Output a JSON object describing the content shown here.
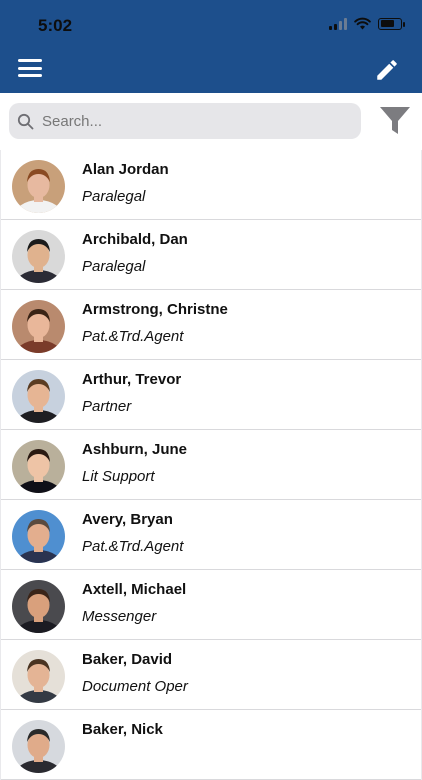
{
  "status_bar": {
    "time": "5:02"
  },
  "header": {
    "menu_icon": "hamburger-menu-icon",
    "edit_icon": "pencil-icon"
  },
  "search": {
    "placeholder": "Search...",
    "value": "",
    "icon": "search-icon",
    "filter_icon": "filter-funnel-icon"
  },
  "contacts": [
    {
      "name": "Alan Jordan",
      "title": "Paralegal",
      "skin": "#e7b9a0",
      "hair": "#8a4a22",
      "shirt": "#f2f2f2",
      "bg": "#c8a07a"
    },
    {
      "name": "Archibald, Dan",
      "title": "Paralegal",
      "skin": "#e0b28e",
      "hair": "#1b1b1b",
      "shirt": "#2b2b35",
      "bg": "#d9d9d9"
    },
    {
      "name": "Armstrong, Christne",
      "title": "Pat.&Trd.Agent",
      "skin": "#e9b79a",
      "hair": "#3a2416",
      "shirt": "#7a3b2a",
      "bg": "#b98a6e"
    },
    {
      "name": "Arthur, Trevor",
      "title": "Partner",
      "skin": "#e6b594",
      "hair": "#5a3c22",
      "shirt": "#1e1e22",
      "bg": "#c7d1de"
    },
    {
      "name": "Ashburn, June",
      "title": "Lit Support",
      "skin": "#eec4a6",
      "hair": "#2a1a12",
      "shirt": "#101018",
      "bg": "#b9b09b"
    },
    {
      "name": "Avery, Bryan",
      "title": "Pat.&Trd.Agent",
      "skin": "#e3ae8e",
      "hair": "#5a4a3e",
      "shirt": "#2a3350",
      "bg": "#4f8fd0"
    },
    {
      "name": "Axtell, Michael",
      "title": "Messenger",
      "skin": "#d9a07c",
      "hair": "#3a2418",
      "shirt": "#1b1b22",
      "bg": "#4a4a4e"
    },
    {
      "name": "Baker, David",
      "title": "Document Oper",
      "skin": "#e4b495",
      "hair": "#4a3422",
      "shirt": "#343a44",
      "bg": "#e5e0d8"
    },
    {
      "name": "Baker, Nick",
      "title": "",
      "skin": "#e0ab8a",
      "hair": "#2a2a2a",
      "shirt": "#2a2a30",
      "bg": "#d6d9de"
    }
  ]
}
